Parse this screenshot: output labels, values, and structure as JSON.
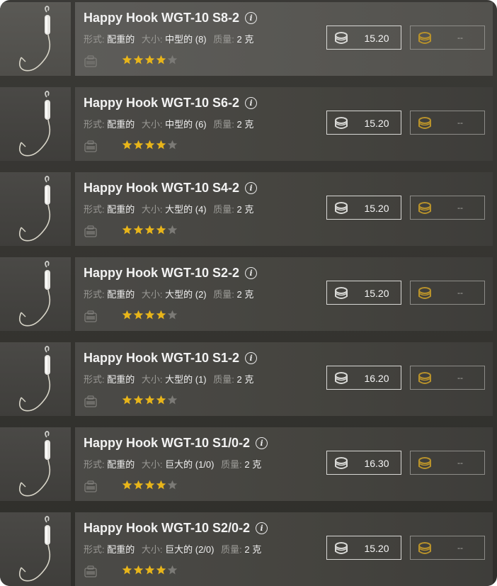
{
  "labels": {
    "form": "形式:",
    "size": "大小:",
    "weight": "质量:"
  },
  "colors": {
    "star_filled": "#e8b51a",
    "star_empty": "#7b7a76",
    "coin_silver": "#d9d9d6",
    "coin_gold": "#b8922b"
  },
  "items": [
    {
      "name": "Happy Hook WGT-10 S8-2",
      "form": "配重的",
      "size": "中型的 (8)",
      "weight": "2 克",
      "rating": 4,
      "silver_price": "15.20",
      "gold_price": "--",
      "selected": true
    },
    {
      "name": "Happy Hook WGT-10 S6-2",
      "form": "配重的",
      "size": "中型的 (6)",
      "weight": "2 克",
      "rating": 4,
      "silver_price": "15.20",
      "gold_price": "--",
      "selected": false
    },
    {
      "name": "Happy Hook WGT-10 S4-2",
      "form": "配重的",
      "size": "大型的 (4)",
      "weight": "2 克",
      "rating": 4,
      "silver_price": "15.20",
      "gold_price": "--",
      "selected": false
    },
    {
      "name": "Happy Hook WGT-10 S2-2",
      "form": "配重的",
      "size": "大型的 (2)",
      "weight": "2 克",
      "rating": 4,
      "silver_price": "15.20",
      "gold_price": "--",
      "selected": false
    },
    {
      "name": "Happy Hook WGT-10 S1-2",
      "form": "配重的",
      "size": "大型的 (1)",
      "weight": "2 克",
      "rating": 4,
      "silver_price": "16.20",
      "gold_price": "--",
      "selected": false
    },
    {
      "name": "Happy Hook WGT-10 S1/0-2",
      "form": "配重的",
      "size": "巨大的 (1/0)",
      "weight": "2 克",
      "rating": 4,
      "silver_price": "16.30",
      "gold_price": "--",
      "selected": false
    },
    {
      "name": "Happy Hook WGT-10 S2/0-2",
      "form": "配重的",
      "size": "巨大的 (2/0)",
      "weight": "2 克",
      "rating": 4,
      "silver_price": "15.20",
      "gold_price": "--",
      "selected": false
    }
  ]
}
